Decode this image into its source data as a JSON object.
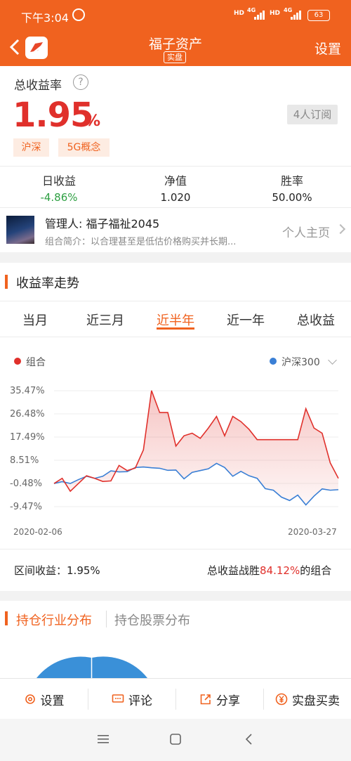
{
  "status_bar": {
    "time": "下午3:04",
    "battery": "63",
    "sig1_hd": "HD",
    "sig1_net": "4G",
    "sig2_hd": "HD",
    "sig2_net": "4G"
  },
  "nav": {
    "title": "福子资产",
    "tag": "实盘",
    "settings": "设置"
  },
  "summary": {
    "label": "总收益率",
    "help": "?",
    "rate": "1.95",
    "pct": "%",
    "subscribers": "4人订阅",
    "chips": [
      "沪深",
      "5G概念"
    ]
  },
  "stats": [
    {
      "label": "日收益",
      "value": "-4.86%",
      "color": "#2ea043"
    },
    {
      "label": "净值",
      "value": "1.020",
      "color": "#222222"
    },
    {
      "label": "胜率",
      "value": "50.00%",
      "color": "#222222"
    }
  ],
  "manager": {
    "name": "管理人: 福子福祉2045",
    "intro": "组合简介：以合理甚至是低估价格购买并长期...",
    "homepage": "个人主页"
  },
  "trend": {
    "title": "收益率走势",
    "tabs": [
      "当月",
      "近三月",
      "近半年",
      "近一年",
      "总收益"
    ],
    "active_tab": 2,
    "legend_portfolio": "组合",
    "legend_benchmark": "沪深300",
    "colors": {
      "portfolio": "#e0302b",
      "benchmark": "#3a7fd5",
      "accent": "#f0621f"
    },
    "interval_label": "区间收益：",
    "interval_value": "1.95%",
    "beat_prefix": "总收益战胜",
    "beat_value": "84.12%",
    "beat_suffix": "的组合"
  },
  "chart_data": {
    "type": "line",
    "y_ticks": [
      "35.47%",
      "26.48%",
      "17.49%",
      "8.51%",
      "-0.48%",
      "-9.47%"
    ],
    "y_tick_values": [
      35.47,
      26.48,
      17.49,
      8.51,
      -0.48,
      -9.47
    ],
    "x_tick_labels": [
      "2020-02-06",
      "2020-03-27"
    ],
    "ylim": [
      -9.47,
      35.47
    ],
    "series": [
      {
        "name": "组合",
        "values": [
          -0.5,
          1.5,
          -3.5,
          -0.5,
          2.5,
          1.5,
          0.3,
          0.5,
          6.5,
          4.5,
          5.5,
          12.5,
          35.5,
          27,
          27,
          14,
          18,
          19,
          17,
          21,
          25.5,
          18,
          25.5,
          23.5,
          20.5,
          16.5,
          16.5,
          16.5,
          16.5,
          16.5,
          16.5,
          28.5,
          21,
          19,
          7.5,
          1.5
        ]
      },
      {
        "name": "沪深300",
        "values": [
          -0.5,
          0.2,
          -0.5,
          1,
          2.3,
          1.5,
          2.3,
          4.4,
          4,
          4.1,
          5.7,
          5.9,
          5.6,
          5.4,
          4.6,
          4.7,
          1.3,
          3.8,
          4.5,
          5.2,
          7.3,
          5.7,
          2.3,
          4.2,
          2.5,
          1.5,
          -2.5,
          -3.1,
          -5.8,
          -7.1,
          -5,
          -8.8,
          -5.4,
          -2.6,
          -3.1,
          -2.9
        ]
      }
    ]
  },
  "distribution": {
    "tab_active": "持仓行业分布",
    "tab_other": "持仓股票分布"
  },
  "bottom_bar": {
    "settings": "设置",
    "comment": "评论",
    "share": "分享",
    "trade": "实盘买卖"
  }
}
